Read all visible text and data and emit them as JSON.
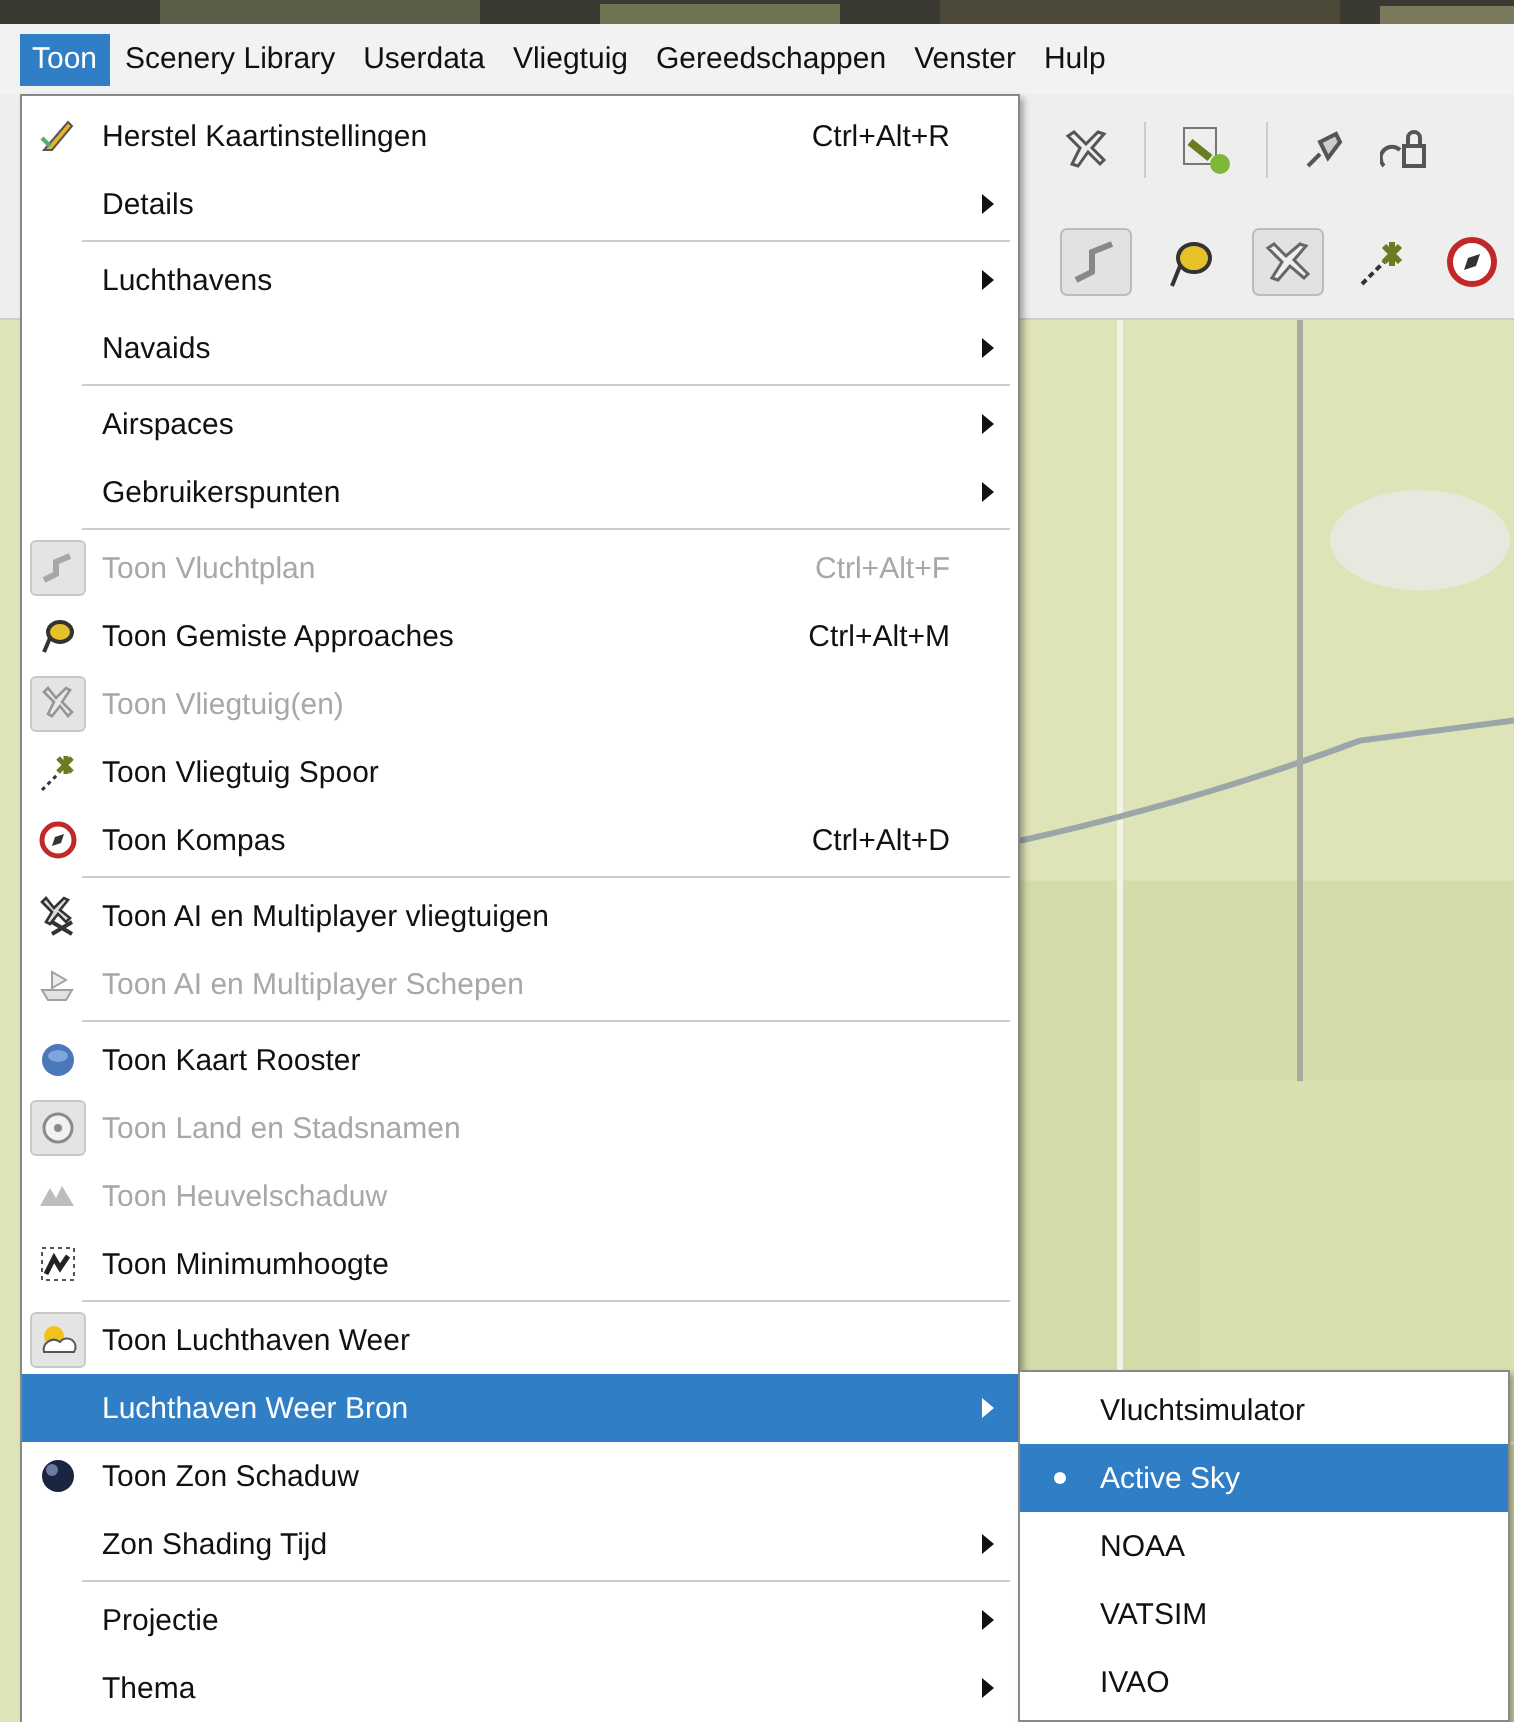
{
  "menubar": [
    {
      "label": "Toon",
      "selected": true
    },
    {
      "label": "Scenery Library",
      "selected": false
    },
    {
      "label": "Userdata",
      "selected": false
    },
    {
      "label": "Vliegtuig",
      "selected": false
    },
    {
      "label": "Gereedschappen",
      "selected": false
    },
    {
      "label": "Venster",
      "selected": false
    },
    {
      "label": "Hulp",
      "selected": false
    }
  ],
  "menu": [
    {
      "kind": "item",
      "label": "Herstel Kaartinstellingen",
      "shortcut": "Ctrl+Alt+R",
      "submenu": false,
      "disabled": false,
      "checked": false,
      "selected": false
    },
    {
      "kind": "item",
      "label": "Details",
      "submenu": true,
      "disabled": false,
      "checked": false,
      "selected": false
    },
    {
      "kind": "separator"
    },
    {
      "kind": "item",
      "label": "Luchthavens",
      "submenu": true,
      "disabled": false,
      "checked": false,
      "selected": false
    },
    {
      "kind": "item",
      "label": "Navaids",
      "submenu": true,
      "disabled": false,
      "checked": false,
      "selected": false
    },
    {
      "kind": "separator"
    },
    {
      "kind": "item",
      "label": "Airspaces",
      "submenu": true,
      "disabled": false,
      "checked": false,
      "selected": false
    },
    {
      "kind": "item",
      "label": "Gebruikerspunten",
      "submenu": true,
      "disabled": false,
      "checked": false,
      "selected": false
    },
    {
      "kind": "separator"
    },
    {
      "kind": "item",
      "label": "Toon Vluchtplan",
      "shortcut": "Ctrl+Alt+F",
      "submenu": false,
      "disabled": true,
      "checked": true,
      "selected": false
    },
    {
      "kind": "item",
      "label": "Toon Gemiste Approaches",
      "shortcut": "Ctrl+Alt+M",
      "submenu": false,
      "disabled": false,
      "checked": false,
      "selected": false
    },
    {
      "kind": "item",
      "label": "Toon Vliegtuig(en)",
      "submenu": false,
      "disabled": true,
      "checked": true,
      "selected": false
    },
    {
      "kind": "item",
      "label": "Toon Vliegtuig Spoor",
      "submenu": false,
      "disabled": false,
      "checked": false,
      "selected": false
    },
    {
      "kind": "item",
      "label": "Toon Kompas",
      "shortcut": "Ctrl+Alt+D",
      "submenu": false,
      "disabled": false,
      "checked": false,
      "selected": false
    },
    {
      "kind": "separator"
    },
    {
      "kind": "item",
      "label": "Toon AI en Multiplayer vliegtuigen",
      "submenu": false,
      "disabled": false,
      "checked": false,
      "selected": false
    },
    {
      "kind": "item",
      "label": "Toon AI en Multiplayer Schepen",
      "submenu": false,
      "disabled": true,
      "checked": false,
      "selected": false
    },
    {
      "kind": "separator"
    },
    {
      "kind": "item",
      "label": "Toon Kaart Rooster",
      "submenu": false,
      "disabled": false,
      "checked": false,
      "selected": false
    },
    {
      "kind": "item",
      "label": "Toon Land en Stadsnamen",
      "submenu": false,
      "disabled": true,
      "checked": true,
      "selected": false
    },
    {
      "kind": "item",
      "label": "Toon Heuvelschaduw",
      "submenu": false,
      "disabled": true,
      "checked": false,
      "selected": false
    },
    {
      "kind": "item",
      "label": "Toon Minimumhoogte",
      "submenu": false,
      "disabled": false,
      "checked": false,
      "selected": false
    },
    {
      "kind": "separator"
    },
    {
      "kind": "item",
      "label": "Toon Luchthaven Weer",
      "submenu": false,
      "disabled": false,
      "checked": true,
      "selected": false
    },
    {
      "kind": "item",
      "label": "Luchthaven Weer Bron",
      "submenu": true,
      "disabled": false,
      "checked": false,
      "selected": true
    },
    {
      "kind": "item",
      "label": "Toon Zon Schaduw",
      "submenu": false,
      "disabled": false,
      "checked": false,
      "selected": false
    },
    {
      "kind": "item",
      "label": "Zon Shading Tijd",
      "submenu": true,
      "disabled": false,
      "checked": false,
      "selected": false
    },
    {
      "kind": "separator"
    },
    {
      "kind": "item",
      "label": "Projectie",
      "submenu": true,
      "disabled": false,
      "checked": false,
      "selected": false
    },
    {
      "kind": "item",
      "label": "Thema",
      "submenu": true,
      "disabled": false,
      "checked": false,
      "selected": false
    }
  ],
  "submenu": [
    {
      "label": "Vluchtsimulator",
      "checked": false,
      "selected": false
    },
    {
      "label": "Active Sky",
      "checked": true,
      "selected": true
    },
    {
      "label": "NOAA",
      "checked": false,
      "selected": false
    },
    {
      "label": "VATSIM",
      "checked": false,
      "selected": false
    },
    {
      "label": "IVAO",
      "checked": false,
      "selected": false
    }
  ]
}
